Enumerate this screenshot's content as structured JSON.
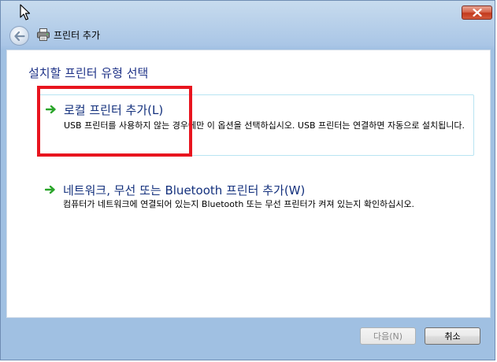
{
  "window": {
    "header_title": "프린터 추가",
    "close_icon": "close-icon",
    "back_icon": "back-arrow-icon"
  },
  "main": {
    "heading": "설치할 프린터 유형 선택",
    "options": [
      {
        "title": "로컬 프린터 추가(L)",
        "description": "USB 프린터를 사용하지 않는 경우에만 이 옵션을 선택하십시오. USB 프린터는 연결하면 자동으로 설치됩니다."
      },
      {
        "title": "네트워크, 무선 또는 Bluetooth 프린터 추가(W)",
        "description": "컴퓨터가 네트워크에 연결되어 있는지 Bluetooth 또는 무선 프린터가 켜져 있는지 확인하십시오."
      }
    ]
  },
  "footer": {
    "next_label": "다음(N)",
    "next_enabled": false,
    "cancel_label": "취소"
  },
  "colors": {
    "accent_text": "#14317d",
    "heading_text": "#1e3287",
    "highlight": "#e8151f",
    "arrow": "#2aa52a"
  }
}
